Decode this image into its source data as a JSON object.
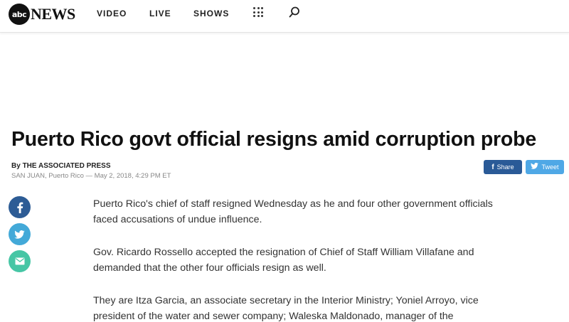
{
  "header": {
    "logo_circle": "abc",
    "logo_text": "NEWS",
    "nav": [
      "VIDEO",
      "LIVE",
      "SHOWS"
    ]
  },
  "article": {
    "headline": "Puerto Rico govt official resigns amid corruption probe",
    "byline_prefix": "By",
    "byline_author": "THE ASSOCIATED PRESS",
    "dateline": "SAN JUAN, Puerto Rico — May 2, 2018, 4:29 PM ET",
    "paragraphs": [
      "Puerto Rico's chief of staff resigned Wednesday as he and four other government officials faced accusations of undue influence.",
      "Gov. Ricardo Rossello accepted the resignation of Chief of Staff William Villafane and demanded that the other four officials resign as well.",
      "They are Itza Garcia, an associate secretary in the Interior Ministry; Yoniel Arroyo, vice president of the water and sewer company; Waleska Maldonado, manager of the"
    ]
  },
  "share": {
    "facebook_label": "Share",
    "facebook_glyph": "f",
    "twitter_label": "Tweet",
    "twitter_glyph": "🐦"
  },
  "colors": {
    "facebook": "#2a5a97",
    "twitter": "#4fa8e6",
    "email": "#46c6a5"
  }
}
